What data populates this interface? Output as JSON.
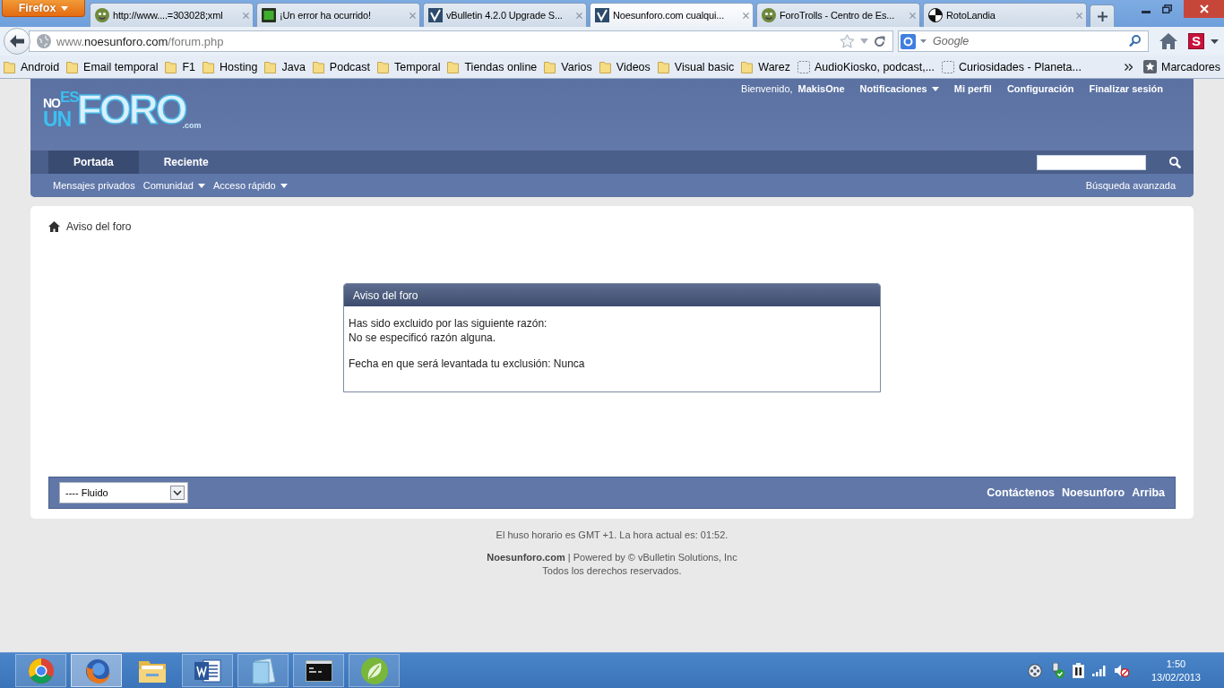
{
  "browser": {
    "menu_button": "Firefox",
    "tabs": [
      {
        "title": "http://www....=303028;xml",
        "selected": false
      },
      {
        "title": "¡Un error ha ocurrido!",
        "selected": false
      },
      {
        "title": "vBulletin 4.2.0 Upgrade S...",
        "selected": false
      },
      {
        "title": "Noesunforo.com cualqui...",
        "selected": true
      },
      {
        "title": "ForoTrolls - Centro de Es...",
        "selected": false
      },
      {
        "title": "RotoLandia",
        "selected": false
      }
    ],
    "address": {
      "prefix": "www.",
      "host": "noesunforo.com",
      "path": "/forum.php"
    },
    "search": {
      "placeholder": "Google"
    },
    "addon_button": "S",
    "bookmarks": [
      {
        "label": "Android",
        "kind": "folder"
      },
      {
        "label": "Email temporal",
        "kind": "folder"
      },
      {
        "label": "F1",
        "kind": "folder"
      },
      {
        "label": "Hosting",
        "kind": "folder"
      },
      {
        "label": "Java",
        "kind": "folder"
      },
      {
        "label": "Podcast",
        "kind": "folder"
      },
      {
        "label": "Temporal",
        "kind": "folder"
      },
      {
        "label": "Tiendas online",
        "kind": "folder"
      },
      {
        "label": "Varios",
        "kind": "folder"
      },
      {
        "label": "Videos",
        "kind": "folder"
      },
      {
        "label": "Visual basic",
        "kind": "folder"
      },
      {
        "label": "Warez",
        "kind": "folder"
      },
      {
        "label": "AudioKiosko, podcast,...",
        "kind": "page"
      },
      {
        "label": "Curiosidades - Planeta...",
        "kind": "page"
      }
    ],
    "bookmarks_menu": "Marcadores"
  },
  "forum": {
    "logo": {
      "top_left": "NO",
      "top_right": "ES",
      "bottom": "UN",
      "main": "FORO",
      "suffix": ".com"
    },
    "welcome": "Bienvenido,",
    "username": "MakisOne",
    "user_links": [
      {
        "label": "Notificaciones",
        "dropdown": true
      },
      {
        "label": "Mi perfil",
        "dropdown": false
      },
      {
        "label": "Configuración",
        "dropdown": false
      },
      {
        "label": "Finalizar sesión",
        "dropdown": false
      }
    ],
    "nav_tabs": [
      {
        "label": "Portada",
        "selected": true
      },
      {
        "label": "Reciente",
        "selected": false
      }
    ],
    "sub_nav": [
      {
        "label": "Mensajes privados",
        "dropdown": false
      },
      {
        "label": "Comunidad",
        "dropdown": true
      },
      {
        "label": "Acceso rápido",
        "dropdown": true
      }
    ],
    "advanced_search": "Búsqueda avanzada",
    "breadcrumb": "Aviso del foro",
    "notice": {
      "title": "Aviso del foro",
      "reason_label": "Has sido excluido por las siguiente razón:",
      "reason": "No se especificó razón alguna.",
      "expiry": "Fecha en que será levantada tu exclusión: Nunca"
    },
    "style_select": {
      "value": "---- Fluido"
    },
    "footer_links": [
      "Contáctenos",
      "Noesunforo",
      "Arriba"
    ],
    "timezone_line": "El huso horario es GMT +1. La hora actual es: 01:52.",
    "copyright": "**Noesunforo.com** | Powered by © vBulletin Solutions, Inc",
    "rights": "Todos los derechos reservados."
  },
  "taskbar": {
    "apps": [
      {
        "running": true,
        "selected": false
      },
      {
        "running": true,
        "selected": true
      },
      {
        "running": false,
        "selected": false
      },
      {
        "running": true,
        "selected": false
      },
      {
        "running": true,
        "selected": false
      },
      {
        "running": true,
        "selected": false
      },
      {
        "running": true,
        "selected": false
      }
    ],
    "clock": {
      "time": "1:50",
      "date": "13/02/2013"
    }
  }
}
